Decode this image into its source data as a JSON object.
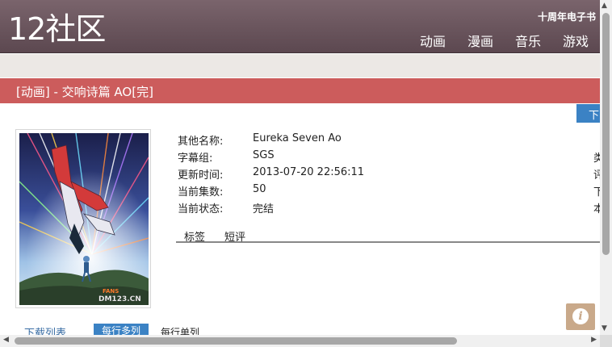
{
  "header": {
    "logo": "12社区",
    "promo": "十周年电子书",
    "nav": [
      "动画",
      "漫画",
      "音乐",
      "游戏"
    ]
  },
  "title": "[动画] - 交响诗篇 AO[完]",
  "download_button_label": "下",
  "info": {
    "rows": [
      {
        "label": "其他名称:",
        "value": "Eureka Seven Ao",
        "right": ""
      },
      {
        "label": "字幕组:",
        "value": "SGS",
        "right": "类"
      },
      {
        "label": "更新时间:",
        "value": "2013-07-20 22:56:11",
        "right": "评"
      },
      {
        "label": "当前集数:",
        "value": "50",
        "right": "下"
      },
      {
        "label": "当前状态:",
        "value": "完结",
        "right": "本"
      }
    ]
  },
  "tabs": [
    "标签",
    "短评"
  ],
  "poster_watermark": "DM123.CN",
  "poster_watermark_top": "FANS",
  "footer": {
    "download_list": "下载列表",
    "multi": "每行多列",
    "single": "每行单列"
  },
  "colors": {
    "header": "#6b5860",
    "title_bar": "#cc5c5c",
    "accent": "#3b82c4",
    "info_button": "#c9a98a"
  }
}
